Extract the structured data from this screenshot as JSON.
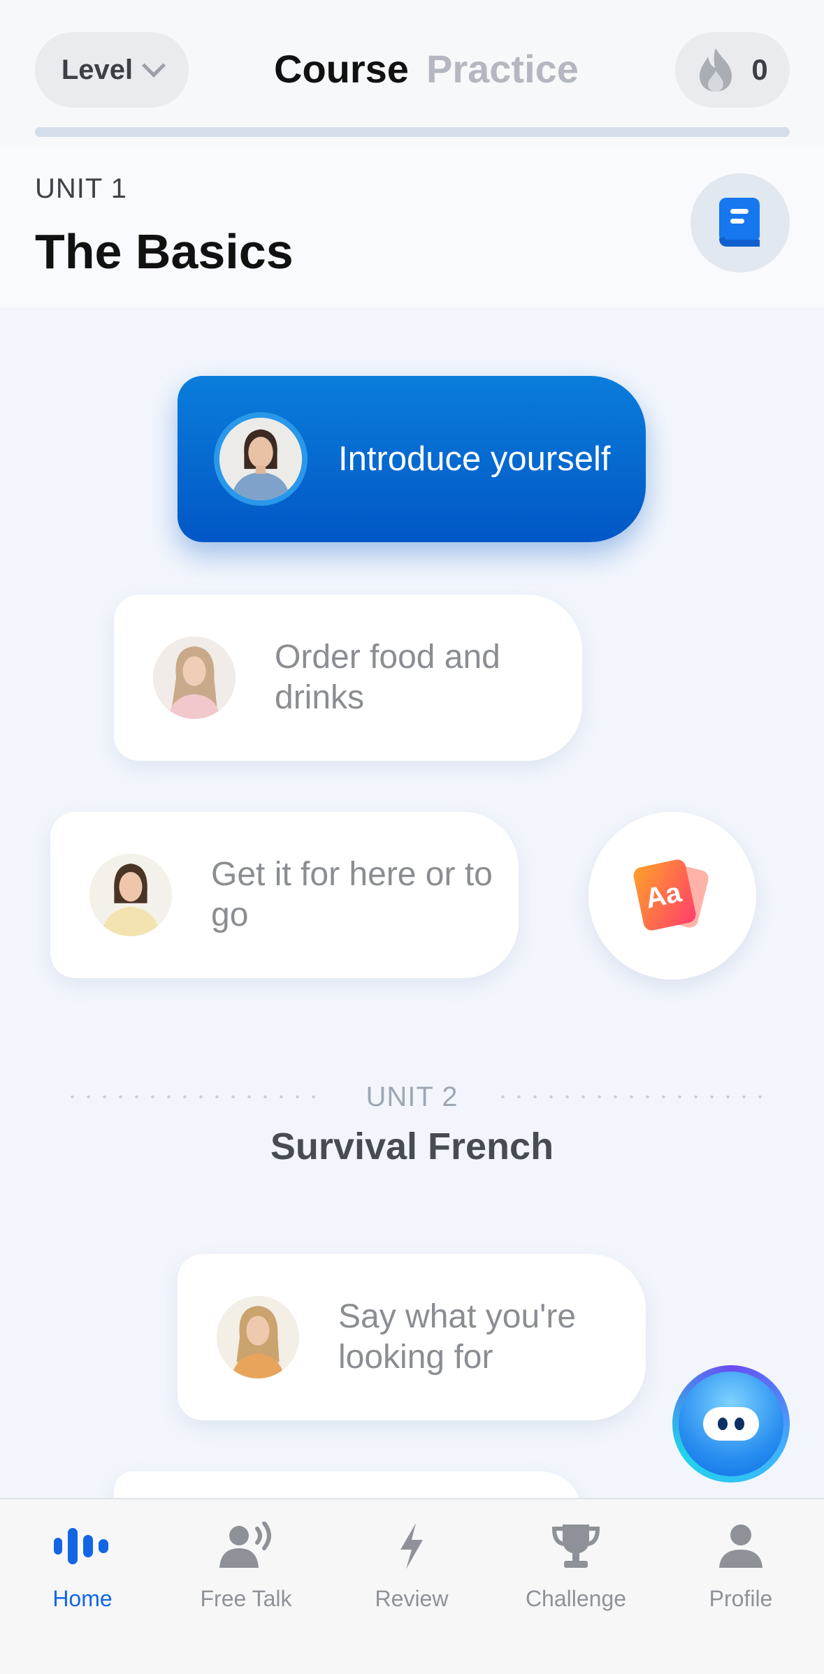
{
  "header": {
    "level_label": "Level",
    "tabs": [
      {
        "label": "Course",
        "active": true
      },
      {
        "label": "Practice",
        "active": false
      }
    ],
    "streak_count": "0",
    "progress_fraction": 0
  },
  "unit1": {
    "label": "UNIT 1",
    "title": "The Basics",
    "guide_icon": "book-icon"
  },
  "lessons": [
    {
      "label": "Introduce yourself",
      "active": true
    },
    {
      "label": "Order food and drinks",
      "active": false
    },
    {
      "label": "Get it for here or to go",
      "active": false
    },
    {
      "label": "Say what you're looking for",
      "active": false
    }
  ],
  "vocab_badge": {
    "text": "Aa",
    "icon": "vocabulary-cards-icon"
  },
  "unit2": {
    "label": "UNIT 2",
    "title": "Survival French"
  },
  "chatbot_icon": "chatbot-icon",
  "nav": [
    {
      "label": "Home",
      "icon": "home-waveform-icon",
      "active": true
    },
    {
      "label": "Free Talk",
      "icon": "free-talk-icon",
      "active": false
    },
    {
      "label": "Review",
      "icon": "lightning-icon",
      "active": false
    },
    {
      "label": "Challenge",
      "icon": "trophy-icon",
      "active": false
    },
    {
      "label": "Profile",
      "icon": "person-icon",
      "active": false
    }
  ],
  "colors": {
    "accent": "#1266e3",
    "active_card": "#0257c6",
    "background": "#f2f6fc"
  }
}
